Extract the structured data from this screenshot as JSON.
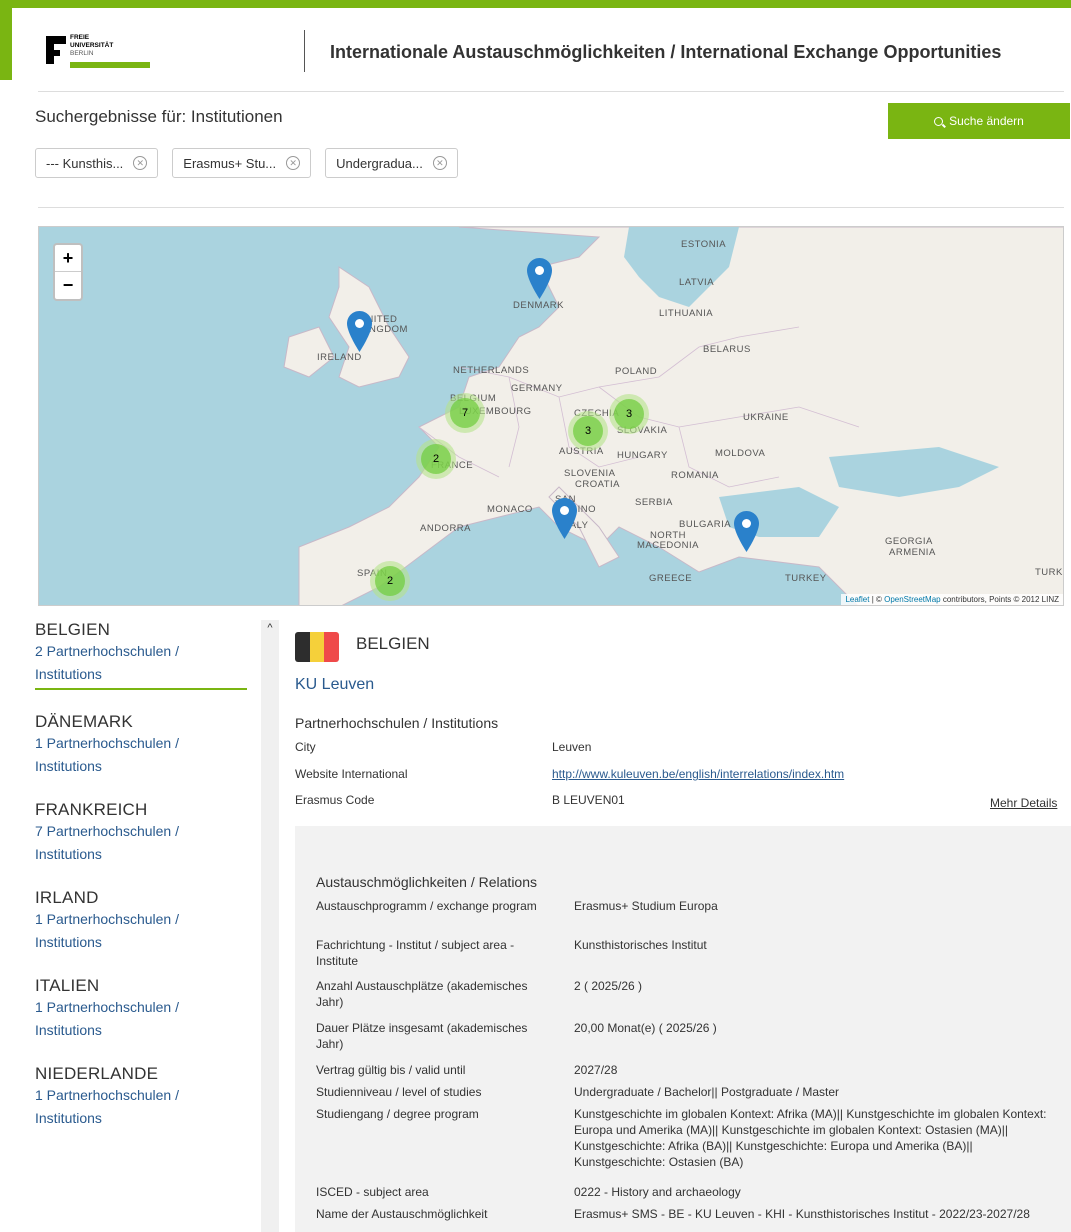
{
  "brand": {
    "logo_lines": [
      "FREIE",
      "UNIVERSITÄT",
      "BERLIN"
    ],
    "accent_color": "#7ab512",
    "link_color": "#2a5a8e"
  },
  "header": {
    "title": "Internationale Austauschmöglichkeiten / International Exchange Opportunities"
  },
  "results": {
    "title": "Suchergebnisse für: Institutionen",
    "search_button": "Suche ändern",
    "chips": [
      {
        "label": "--- Kunsthis..."
      },
      {
        "label": "Erasmus+ Stu..."
      },
      {
        "label": "Undergradua..."
      }
    ]
  },
  "map": {
    "zoom_in": "+",
    "zoom_out": "−",
    "country_labels": [
      "ESTONIA",
      "LATVIA",
      "DENMARK",
      "LITHUANIA",
      "UNITED KINGDOM",
      "IRELAND",
      "BELARUS",
      "NETHERLANDS",
      "POLAND",
      "GERMANY",
      "BELGIUM",
      "LUXEMBOURG",
      "CZECHIA",
      "SLOVAKIA",
      "UKRAINE",
      "AUSTRIA",
      "HUNGARY",
      "MOLDOVA",
      "FRANCE",
      "SLOVENIA",
      "CROATIA",
      "ROMANIA",
      "SERBIA",
      "MONACO",
      "SAN MARINO",
      "ITALY",
      "ANDORRA",
      "BULGARIA",
      "NORTH MACEDONIA",
      "GEORGIA",
      "ARMENIA",
      "SPAIN",
      "GREECE",
      "TURKEY",
      "TURK"
    ],
    "clusters": [
      {
        "count": "7",
        "region": "Belgium"
      },
      {
        "count": "3",
        "region": "Slovakia"
      },
      {
        "count": "3",
        "region": "Austria"
      },
      {
        "count": "2",
        "region": "France"
      },
      {
        "count": "2",
        "region": "Spain"
      }
    ],
    "markers": [
      "Denmark",
      "United Kingdom",
      "Italy",
      "Turkey"
    ],
    "attribution": {
      "leaflet": "Leaflet",
      "osm": "OpenStreetMap",
      "rest": "contributors, Points © 2012 LINZ"
    }
  },
  "sidebar": {
    "countries": [
      {
        "name": "BELGIEN",
        "count": "2 Partnerhochschulen / Institutions"
      },
      {
        "name": "DÄNEMARK",
        "count": "1 Partnerhochschulen / Institutions"
      },
      {
        "name": "FRANKREICH",
        "count": "7 Partnerhochschulen / Institutions"
      },
      {
        "name": "IRLAND",
        "count": "1 Partnerhochschulen / Institutions"
      },
      {
        "name": "ITALIEN",
        "count": "1 Partnerhochschulen / Institutions"
      },
      {
        "name": "NIEDERLANDE",
        "count": "1 Partnerhochschulen / Institutions"
      }
    ]
  },
  "detail": {
    "country": "BELGIEN",
    "flag_colors": [
      "#2d2d2d",
      "#f5d03a",
      "#ef4a4a"
    ],
    "institution": "KU Leuven",
    "section_title": "Partnerhochschulen / Institutions",
    "fields": [
      {
        "key": "City",
        "value": "Leuven"
      },
      {
        "key": "Website International",
        "value": "http://www.kuleuven.be/english/interrelations/index.htm"
      },
      {
        "key": "Erasmus Code",
        "value": "B LEUVEN01"
      }
    ],
    "more_link": "Mehr Details"
  },
  "relations": {
    "title": "Austauschmöglichkeiten / Relations",
    "rows": [
      {
        "key": "Austauschprogramm / exchange program",
        "value": "Erasmus+ Studium Europa"
      },
      {
        "key": "Fachrichtung - Institut / subject area - Institute",
        "value": "Kunsthistorisches Institut"
      },
      {
        "key": "Anzahl Austauschplätze (akademisches Jahr)",
        "value": "2 ( 2025/26 )"
      },
      {
        "key": "Dauer Plätze insgesamt (akademisches Jahr)",
        "value": "20,00 Monat(e) ( 2025/26 )"
      },
      {
        "key": "Vertrag gültig bis / valid until",
        "value": "2027/28"
      },
      {
        "key": "Studienniveau / level of studies",
        "value": "Undergraduate / Bachelor|| Postgraduate / Master"
      },
      {
        "key": "Studiengang / degree program",
        "value": "Kunstgeschichte im globalen Kontext: Afrika (MA)|| Kunstgeschichte im globalen Kontext: Europa und Amerika (MA)|| Kunstgeschichte im globalen Kontext: Ostasien (MA)|| Kunstgeschichte: Afrika (BA)|| Kunstgeschichte: Europa und Amerika (BA)|| Kunstgeschichte: Ostasien (BA)"
      },
      {
        "key": "ISCED - subject area",
        "value": "0222 - History and archaeology"
      },
      {
        "key": "Name der Austauschmöglichkeit",
        "value": "Erasmus+ SMS - BE - KU Leuven - KHI - Kunsthistorisches Institut - 2022/23-2027/28"
      }
    ]
  }
}
